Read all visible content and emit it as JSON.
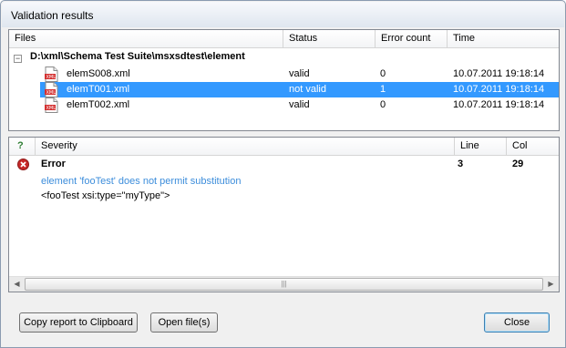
{
  "window": {
    "title": "Validation results"
  },
  "files_table": {
    "columns": {
      "files": "Files",
      "status": "Status",
      "error_count": "Error count",
      "time": "Time"
    },
    "toggle": "−",
    "root_path": "D:\\xml\\Schema Test Suite\\msxsdtest\\element",
    "rows": [
      {
        "name": "elemS008.xml",
        "status": "valid",
        "error_count": "0",
        "time": "10.07.2011 19:18:14",
        "selected": false
      },
      {
        "name": "elemT001.xml",
        "status": "not valid",
        "error_count": "1",
        "time": "10.07.2011 19:18:14",
        "selected": true
      },
      {
        "name": "elemT002.xml",
        "status": "valid",
        "error_count": "0",
        "time": "10.07.2011 19:18:14",
        "selected": false
      }
    ]
  },
  "errors_table": {
    "columns": {
      "flag": "?",
      "severity": "Severity",
      "line": "Line",
      "col": "Col"
    },
    "rows": [
      {
        "severity": "Error",
        "line": "3",
        "col": "29",
        "message": "element 'fooTest' does not permit substitution",
        "snippet": "<fooTest xsi:type=\"myType\">"
      }
    ]
  },
  "buttons": {
    "copy": "Copy report to Clipboard",
    "open": "Open file(s)",
    "close": "Close"
  },
  "icons": {
    "file": "xml-file-icon",
    "error": "error-x-icon"
  },
  "colors": {
    "selection": "#3399ff",
    "message": "#3c8ddb",
    "error_icon": "#c62828"
  }
}
